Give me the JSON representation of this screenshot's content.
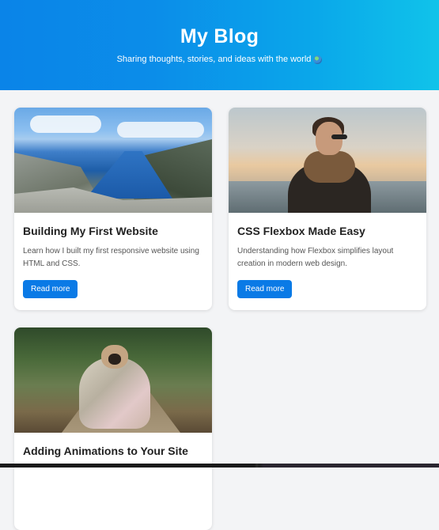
{
  "header": {
    "title": "My Blog",
    "subtitle": "Sharing thoughts, stories, and ideas with the world",
    "globe_icon": "globe-icon"
  },
  "posts": [
    {
      "title": "Building My First Website",
      "description": "Learn how I built my first responsive website using HTML and CSS.",
      "button": "Read more",
      "image": "fjord-landscape"
    },
    {
      "title": "CSS Flexbox Made Easy",
      "description": "Understanding how Flexbox simplifies layout creation in modern web design.",
      "button": "Read more",
      "image": "person-at-sea"
    },
    {
      "title": "Adding Animations to Your Site",
      "image": "pug-in-blanket"
    }
  ],
  "colors": {
    "accent": "#0a7ae6",
    "header_gradient_start": "#0a84e8",
    "header_gradient_end": "#10c3ea"
  }
}
